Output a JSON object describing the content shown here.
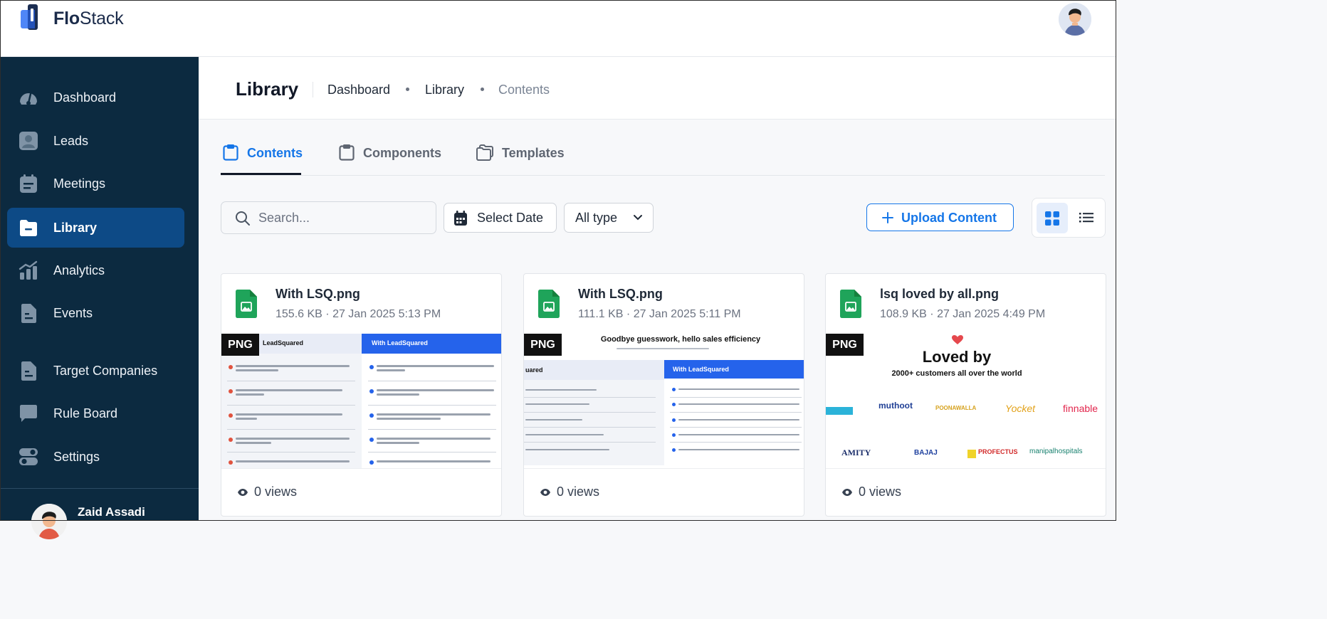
{
  "app": {
    "logo_bold": "Flo",
    "logo_light": "Stack"
  },
  "sidebar": {
    "items": [
      {
        "label": "Dashboard",
        "icon": "gauge-icon"
      },
      {
        "label": "Leads",
        "icon": "user-card-icon"
      },
      {
        "label": "Meetings",
        "icon": "calendar-icon"
      },
      {
        "label": "Library",
        "icon": "folder-icon",
        "active": true
      },
      {
        "label": "Analytics",
        "icon": "chart-icon"
      },
      {
        "label": "Events",
        "icon": "document-icon"
      },
      {
        "label": "Target Companies",
        "icon": "document-icon"
      },
      {
        "label": "Rule Board",
        "icon": "message-board-icon"
      },
      {
        "label": "Settings",
        "icon": "toggle-icon"
      }
    ],
    "user_name": "Zaid Assadi"
  },
  "page": {
    "title": "Library",
    "breadcrumb": [
      "Dashboard",
      "Library",
      "Contents"
    ]
  },
  "tabs": [
    {
      "label": "Contents",
      "icon": "clipboard-icon",
      "active": true
    },
    {
      "label": "Components",
      "icon": "clipboard-icon"
    },
    {
      "label": "Templates",
      "icon": "folders-icon"
    }
  ],
  "toolbar": {
    "search_placeholder": "Search...",
    "date_label": "Select Date",
    "type_label": "All type",
    "upload_label": "Upload Content",
    "view_mode": "grid"
  },
  "cards": [
    {
      "title": "With LSQ.png",
      "size": "155.6 KB",
      "date": "27 Jan 2025 5:13 PM",
      "badge": "PNG",
      "views": "0 views",
      "preview": {
        "left_head": "LeadSquared",
        "right_head": "With LeadSquared"
      }
    },
    {
      "title": "With LSQ.png",
      "size": "111.1 KB",
      "date": "27 Jan 2025 5:11 PM",
      "badge": "PNG",
      "views": "0 views",
      "preview": {
        "headline": "Goodbye guesswork, hello sales efficiency",
        "left_head": "uared",
        "right_head": "With LeadSquared"
      }
    },
    {
      "title": "lsq loved by all.png",
      "size": "108.9 KB",
      "date": "27 Jan 2025 4:49 PM",
      "badge": "PNG",
      "views": "0 views",
      "preview": {
        "headline": "Loved by",
        "subline": "2000+ customers all over the world",
        "logos_row1": [
          "muthoot",
          "POONAWALLA",
          "Yocket",
          "finnable"
        ],
        "logos_row2": [
          "AMITY",
          "BAJAJ",
          "PROFECTUS",
          "manipalhospitals"
        ]
      }
    }
  ],
  "colors": {
    "sidebar_bg": "#0c2a40",
    "sidebar_active": "#0d4a86",
    "accent": "#1576e8",
    "file_icon": "#1fa45a"
  }
}
